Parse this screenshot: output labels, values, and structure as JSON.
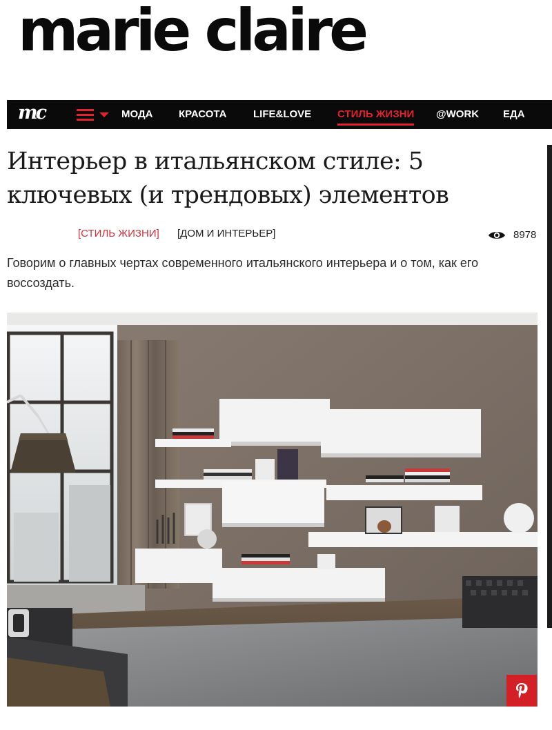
{
  "logo": {
    "text": "marie claire"
  },
  "nav": {
    "brand": "mc",
    "items": [
      {
        "label": "МОДА",
        "active": false
      },
      {
        "label": "КРАСОТА",
        "active": false
      },
      {
        "label": "LIFE&LOVE",
        "active": false
      },
      {
        "label": "СТИЛЬ ЖИЗНИ",
        "active": true
      },
      {
        "label": "@WORK",
        "active": false
      },
      {
        "label": "ЕДА",
        "active": false
      }
    ]
  },
  "article": {
    "title": "Интерьер в итальянском стиле: 5 ключевых (и трендовых) элементов",
    "tags": [
      "[СТИЛЬ ЖИЗНИ]",
      "[ДОМ И ИНТЕРЬЕР]"
    ],
    "views": "8978",
    "lead": "Говорим о главных чертах современного итальянского интерьера и о том, как его воссоздать."
  },
  "hero_image": {
    "subject": "living-room-interior"
  },
  "colors": {
    "accent": "#e0232f",
    "nav_bg": "#0a0a0a",
    "pinterest": "#d32026"
  },
  "icons": {
    "views": "eye-icon",
    "share": "pinterest-icon",
    "menu": "hamburger-icon"
  }
}
